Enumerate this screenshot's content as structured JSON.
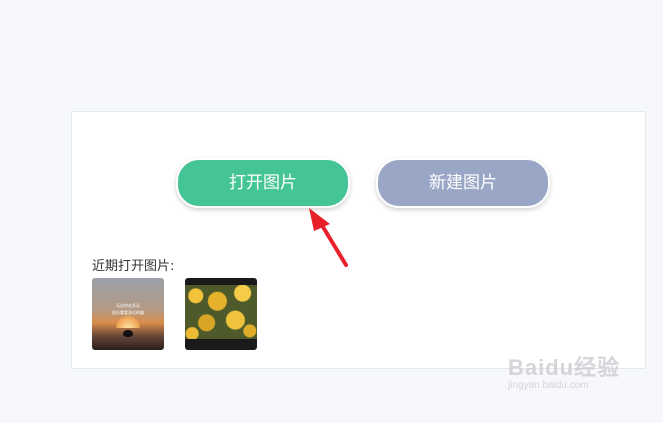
{
  "main": {
    "open_button_label": "打开图片",
    "new_button_label": "新建图片",
    "recent_label": "近期打开图片:",
    "recent_images": [
      {
        "caption_line1": "无论你走多远",
        "caption_line2": "回头看看身后的路"
      },
      {}
    ]
  },
  "watermark": {
    "main": "Baidu经验",
    "sub": "jingyan.baidu.com"
  },
  "colors": {
    "open_button": "#45c595",
    "new_button": "#9aa6c6",
    "arrow": "#e8202a"
  }
}
